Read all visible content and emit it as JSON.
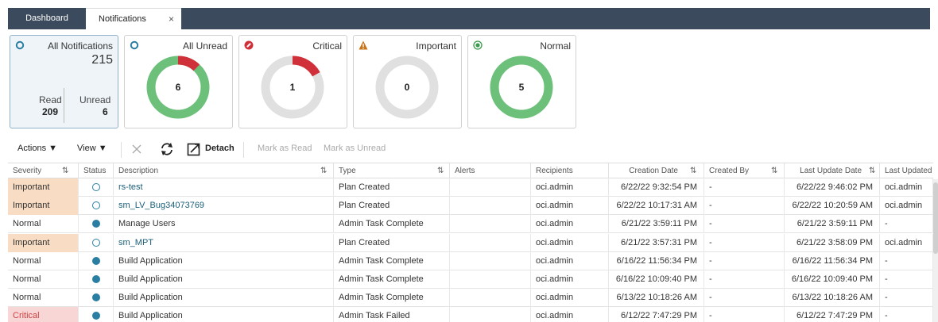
{
  "tabs": [
    {
      "label": "Dashboard",
      "active": false
    },
    {
      "label": "Notifications",
      "active": true,
      "close": "×"
    }
  ],
  "cards": {
    "all": {
      "title": "All Notifications",
      "total": "215",
      "read_label": "Read",
      "read_value": "209",
      "unread_label": "Unread",
      "unread_value": "6"
    },
    "unread": {
      "title": "All Unread",
      "value": "6",
      "red_fraction": 0.12
    },
    "critical": {
      "title": "Critical",
      "value": "1",
      "red_fraction": 0.17
    },
    "important": {
      "title": "Important",
      "value": "0",
      "red_fraction": 0
    },
    "normal": {
      "title": "Normal",
      "value": "5",
      "green_fraction": 1
    }
  },
  "toolbar": {
    "actions": "Actions ▼",
    "view": "View ▼",
    "detach": "Detach",
    "mark_read": "Mark as Read",
    "mark_unread": "Mark as Unread"
  },
  "columns": {
    "severity": "Severity",
    "status": "Status",
    "description": "Description",
    "type": "Type",
    "alerts": "Alerts",
    "recipients": "Recipients",
    "creation_date": "Creation Date",
    "created_by": "Created By",
    "last_update_date": "Last Update Date",
    "last_updated_by": "Last Updated By"
  },
  "rows": [
    {
      "severity": "Important",
      "status": "unread",
      "description": "rs-test",
      "type": "Plan Created",
      "alerts": "",
      "recipients": "oci.admin",
      "creation_date": "6/22/22 9:32:54 PM",
      "created_by": "-",
      "last_update_date": "6/22/22 9:46:02 PM",
      "last_updated_by": "oci.admin"
    },
    {
      "severity": "Important",
      "status": "unread",
      "description": "sm_LV_Bug34073769",
      "type": "Plan Created",
      "alerts": "",
      "recipients": "oci.admin",
      "creation_date": "6/22/22 10:17:31 AM",
      "created_by": "-",
      "last_update_date": "6/22/22 10:20:59 AM",
      "last_updated_by": "oci.admin"
    },
    {
      "severity": "Normal",
      "status": "read",
      "description": "Manage Users",
      "type": "Admin Task Complete",
      "alerts": "",
      "recipients": "oci.admin",
      "creation_date": "6/21/22 3:59:11 PM",
      "created_by": "-",
      "last_update_date": "6/21/22 3:59:11 PM",
      "last_updated_by": "-"
    },
    {
      "severity": "Important",
      "status": "unread",
      "description": "sm_MPT",
      "type": "Plan Created",
      "alerts": "",
      "recipients": "oci.admin",
      "creation_date": "6/21/22 3:57:31 PM",
      "created_by": "-",
      "last_update_date": "6/21/22 3:58:09 PM",
      "last_updated_by": "oci.admin"
    },
    {
      "severity": "Normal",
      "status": "read",
      "description": "Build Application",
      "type": "Admin Task Complete",
      "alerts": "",
      "recipients": "oci.admin",
      "creation_date": "6/16/22 11:56:34 PM",
      "created_by": "-",
      "last_update_date": "6/16/22 11:56:34 PM",
      "last_updated_by": "-"
    },
    {
      "severity": "Normal",
      "status": "read",
      "description": "Build Application",
      "type": "Admin Task Complete",
      "alerts": "",
      "recipients": "oci.admin",
      "creation_date": "6/16/22 10:09:40 PM",
      "created_by": "-",
      "last_update_date": "6/16/22 10:09:40 PM",
      "last_updated_by": "-"
    },
    {
      "severity": "Normal",
      "status": "read",
      "description": "Build Application",
      "type": "Admin Task Complete",
      "alerts": "",
      "recipients": "oci.admin",
      "creation_date": "6/13/22 10:18:26 AM",
      "created_by": "-",
      "last_update_date": "6/13/22 10:18:26 AM",
      "last_updated_by": "-"
    },
    {
      "severity": "Critical",
      "status": "read",
      "description": "Build Application",
      "type": "Admin Task Failed",
      "alerts": "",
      "recipients": "oci.admin",
      "creation_date": "6/12/22 7:47:29 PM",
      "created_by": "-",
      "last_update_date": "6/12/22 7:47:29 PM",
      "last_updated_by": "-"
    }
  ],
  "colors": {
    "accent": "#2a7ea1",
    "green": "#6cc07a",
    "red": "#d0303a",
    "grey_ring": "#e0e0e0",
    "important_bg": "#f8dcc3",
    "critical_bg": "#f9d6d6",
    "tabbar": "#3b4a5c"
  }
}
